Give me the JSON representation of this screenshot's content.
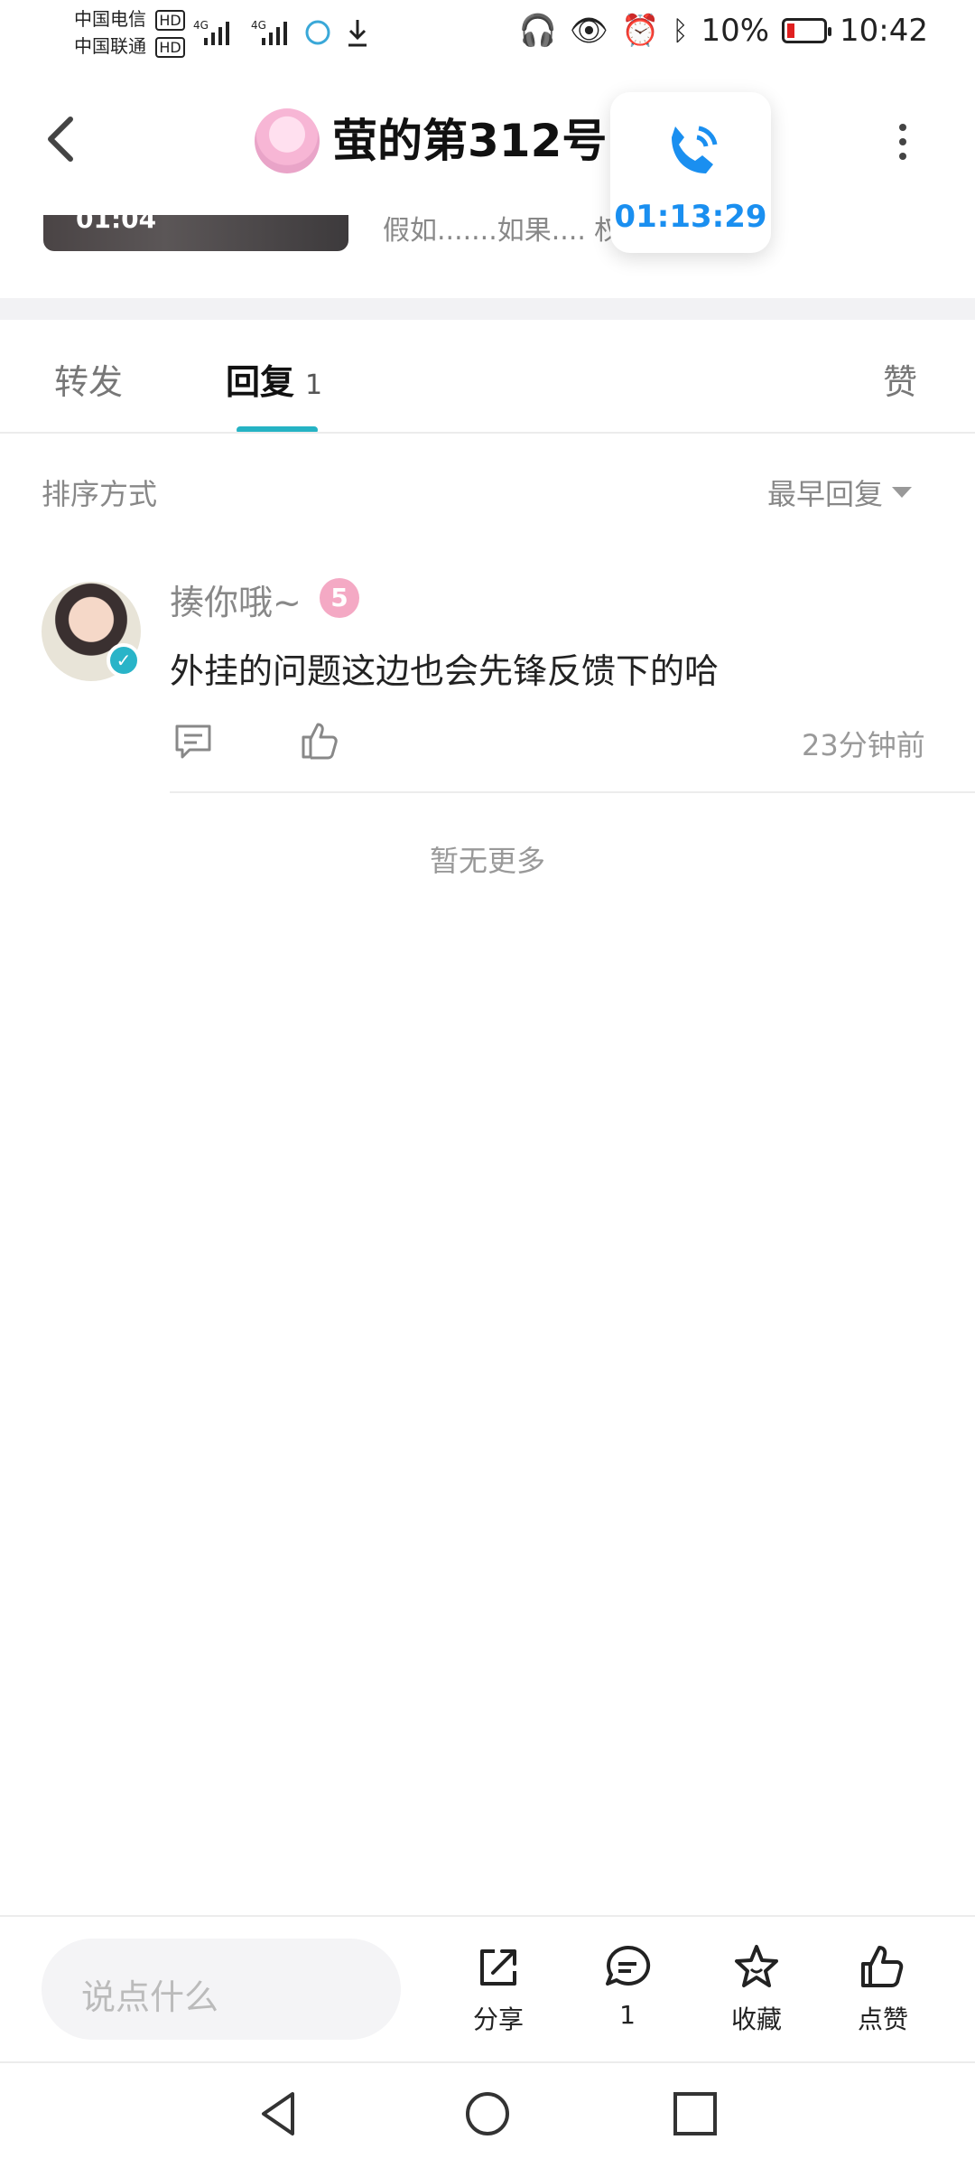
{
  "status_bar": {
    "carrier1": "中国电信",
    "carrier2": "中国联通",
    "battery": "10%",
    "time": "10:42"
  },
  "header": {
    "title": "萤的第312号",
    "call_duration": "01:13:29"
  },
  "post_preview": {
    "video_time": "01:04",
    "snippet": "假如.......如果....              权"
  },
  "tabs": [
    {
      "label": "转发"
    },
    {
      "label": "回复",
      "count": "1"
    },
    {
      "label": "赞"
    }
  ],
  "sort": {
    "label": "排序方式",
    "value": "最早回复"
  },
  "comment": {
    "username": "揍你哦~",
    "level": "5",
    "text": "外挂的问题这边也会先锋反馈下的哈",
    "time": "23分钟前"
  },
  "no_more": "暂无更多",
  "bottom_bar": {
    "input_placeholder": "说点什么",
    "share": "分享",
    "comment_count": "1",
    "favorite": "收藏",
    "like": "点赞"
  },
  "colors": {
    "accent": "#25b3c4",
    "call_blue": "#1a8ff0"
  }
}
